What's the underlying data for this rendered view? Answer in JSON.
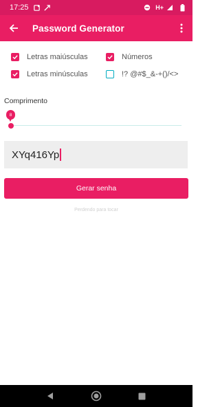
{
  "status_bar": {
    "time": "17:25",
    "network": "H+",
    "icons": [
      "app-notification-icon",
      "rocket-icon",
      "do-not-disturb-icon",
      "signal-icon",
      "battery-icon"
    ]
  },
  "app_bar": {
    "title": "Password Generator",
    "back_icon": "arrow-back-icon",
    "menu_icon": "more-vert-icon"
  },
  "options": [
    {
      "label": "Letras maiúsculas",
      "checked": true
    },
    {
      "label": "Números",
      "checked": true
    },
    {
      "label": "Letras minúsculas",
      "checked": true
    },
    {
      "label": "!? @#$_&-+()/<>",
      "checked": false
    }
  ],
  "length": {
    "label": "Comprimento",
    "value": "8"
  },
  "password": {
    "value": "XYq416Yp"
  },
  "generate_button": {
    "label": "Gerar senha"
  },
  "credit": {
    "text": "Perdendo para tocar"
  },
  "colors": {
    "primary": "#e91e63",
    "status_bar": "#d81b60",
    "accent": "#00acc1",
    "password_bg": "#eeeeee"
  }
}
